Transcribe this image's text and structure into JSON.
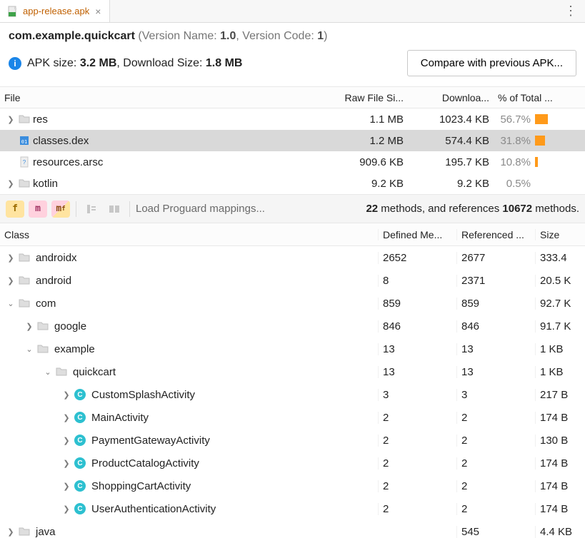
{
  "tab": {
    "label": "app-release.apk"
  },
  "header": {
    "package": "com.example.quickcart",
    "version_name_label": "Version Name:",
    "version_name": "1.0",
    "version_code_label": "Version Code:",
    "version_code": "1",
    "apk_size_label": "APK size:",
    "apk_size": "3.2 MB",
    "download_size_label": "Download Size:",
    "download_size": "1.8 MB",
    "compare_button": "Compare with previous APK..."
  },
  "file_table": {
    "columns": {
      "file": "File",
      "raw": "Raw File Si...",
      "download": "Downloa...",
      "pct": "% of Total ..."
    },
    "rows": [
      {
        "name": "res",
        "raw": "1.1 MB",
        "download": "1023.4 KB",
        "pct": "56.7%",
        "bar": 18,
        "icon": "folder",
        "expandable": true,
        "selected": false
      },
      {
        "name": "classes.dex",
        "raw": "1.2 MB",
        "download": "574.4 KB",
        "pct": "31.8%",
        "bar": 14,
        "icon": "dex",
        "expandable": false,
        "selected": true
      },
      {
        "name": "resources.arsc",
        "raw": "909.6 KB",
        "download": "195.7 KB",
        "pct": "10.8%",
        "bar": 4,
        "icon": "arsc",
        "expandable": false,
        "selected": false
      },
      {
        "name": "kotlin",
        "raw": "9.2 KB",
        "download": "9.2 KB",
        "pct": "0.5%",
        "bar": 0,
        "icon": "folder",
        "expandable": true,
        "selected": false
      }
    ]
  },
  "toolbar": {
    "load_mappings": "Load Proguard mappings...",
    "stats_mid": "22",
    "stats_mid_suffix": " methods, and references ",
    "stats_ref": "10672",
    "stats_ref_suffix": " methods."
  },
  "class_table": {
    "columns": {
      "class": "Class",
      "defined": "Defined Me...",
      "referenced": "Referenced ...",
      "size": "Size"
    },
    "rows": [
      {
        "depth": 0,
        "exp": "closed",
        "kind": "pkg",
        "name": "androidx",
        "defined": "2652",
        "referenced": "2677",
        "size": "333.4"
      },
      {
        "depth": 0,
        "exp": "closed",
        "kind": "pkg",
        "name": "android",
        "defined": "8",
        "referenced": "2371",
        "size": "20.5 K"
      },
      {
        "depth": 0,
        "exp": "open",
        "kind": "pkg",
        "name": "com",
        "defined": "859",
        "referenced": "859",
        "size": "92.7 K"
      },
      {
        "depth": 1,
        "exp": "closed",
        "kind": "pkg",
        "name": "google",
        "defined": "846",
        "referenced": "846",
        "size": "91.7 K"
      },
      {
        "depth": 1,
        "exp": "open",
        "kind": "pkg",
        "name": "example",
        "defined": "13",
        "referenced": "13",
        "size": "1 KB"
      },
      {
        "depth": 2,
        "exp": "open",
        "kind": "pkg",
        "name": "quickcart",
        "defined": "13",
        "referenced": "13",
        "size": "1 KB"
      },
      {
        "depth": 3,
        "exp": "closed",
        "kind": "cls",
        "name": "CustomSplashActivity",
        "defined": "3",
        "referenced": "3",
        "size": "217 B"
      },
      {
        "depth": 3,
        "exp": "closed",
        "kind": "cls",
        "name": "MainActivity",
        "defined": "2",
        "referenced": "2",
        "size": "174 B"
      },
      {
        "depth": 3,
        "exp": "closed",
        "kind": "cls",
        "name": "PaymentGatewayActivity",
        "defined": "2",
        "referenced": "2",
        "size": "130 B"
      },
      {
        "depth": 3,
        "exp": "closed",
        "kind": "cls",
        "name": "ProductCatalogActivity",
        "defined": "2",
        "referenced": "2",
        "size": "174 B"
      },
      {
        "depth": 3,
        "exp": "closed",
        "kind": "cls",
        "name": "ShoppingCartActivity",
        "defined": "2",
        "referenced": "2",
        "size": "174 B"
      },
      {
        "depth": 3,
        "exp": "closed",
        "kind": "cls",
        "name": "UserAuthenticationActivity",
        "defined": "2",
        "referenced": "2",
        "size": "174 B"
      },
      {
        "depth": 0,
        "exp": "closed",
        "kind": "pkg",
        "name": "java",
        "defined": "",
        "referenced": "545",
        "size": "4.4 KB"
      }
    ]
  }
}
